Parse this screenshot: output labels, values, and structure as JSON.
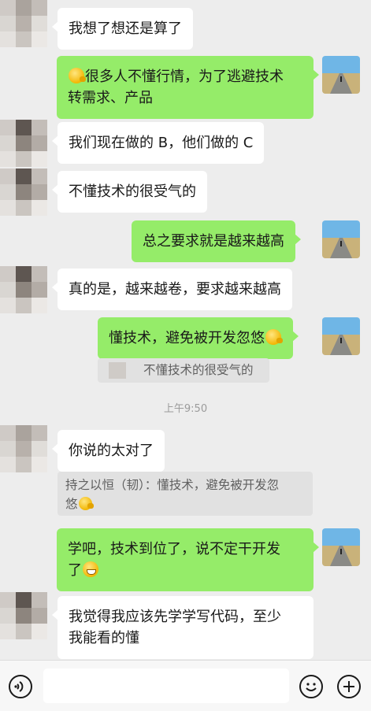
{
  "messages": [
    {
      "text": "我想了想还是算了"
    },
    {
      "line1": "很多人不懂行情，为了逃避技术",
      "line2": "转需求、产品"
    },
    {
      "text": "我们现在做的 B，他们做的 C"
    },
    {
      "text": "不懂技术的很受气的"
    },
    {
      "text": "总之要求就是越来越高"
    },
    {
      "text": "真的是，越来越卷，要求越来越高"
    },
    {
      "text": "懂技术，避免被开发忽悠"
    },
    {
      "quote": "不懂技术的很受气的"
    },
    {
      "time": "上午9:50"
    },
    {
      "text": "你说的太对了",
      "quote_line1": "持之以恒（韧）：懂技术，避免被开发忽",
      "quote_line2": "悠"
    },
    {
      "line1": "学吧，技术到位了，说不定干开发",
      "line2": "了"
    },
    {
      "line1": "我觉得我应该先学学写代码，至少",
      "line2": "我能看的懂"
    }
  ],
  "icons": {
    "voice": "voice-icon",
    "emoji": "emoji-icon",
    "add": "add-icon"
  },
  "colors": {
    "background": "#ededed",
    "incoming_bubble": "#ffffff",
    "outgoing_bubble": "#95ec69",
    "quote_bg": "#e1e1e1"
  }
}
